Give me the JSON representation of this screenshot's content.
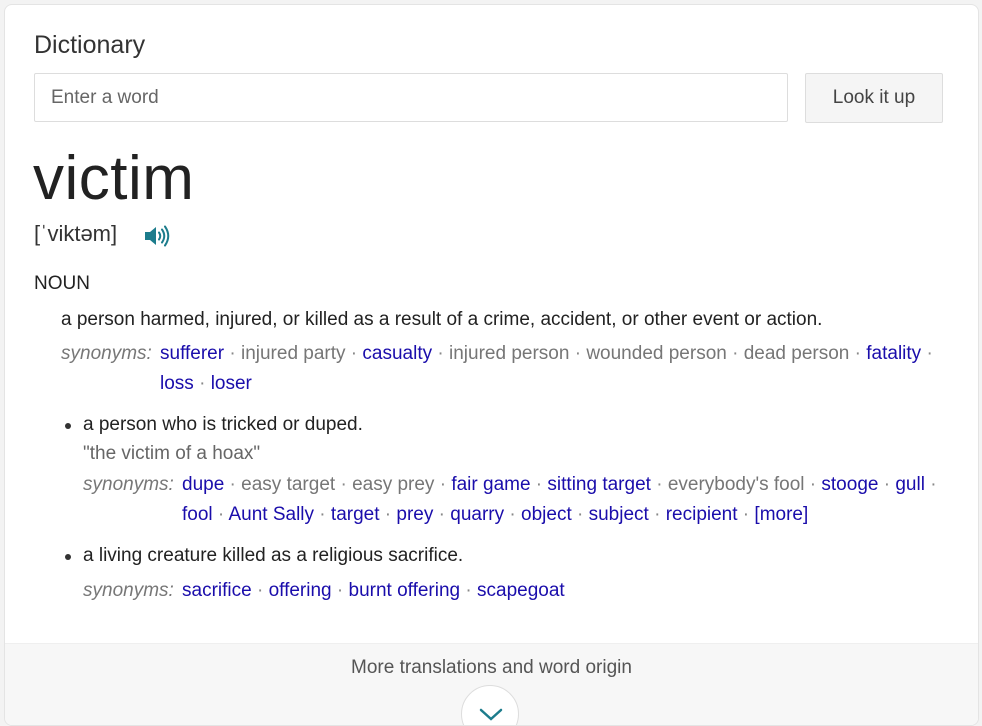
{
  "panel": {
    "title": "Dictionary",
    "search": {
      "placeholder": "Enter a word",
      "value": ""
    },
    "lookup_label": "Look it up"
  },
  "entry": {
    "word": "victim",
    "pronunciation": "[ˈviktəm]",
    "speaker_icon": "speaker-icon",
    "part_of_speech": "NOUN",
    "synonyms_label": "synonyms:",
    "senses": [
      {
        "definition": "a person harmed, injured, or killed as a result of a crime, accident, or other event or action.",
        "synonym_lines": [
          [
            {
              "text": "sufferer",
              "link": true
            },
            {
              "text": "injured party",
              "link": false
            },
            {
              "text": "casualty",
              "link": true
            },
            {
              "text": "injured person",
              "link": false
            },
            {
              "text": "wounded person",
              "link": false
            },
            {
              "text": "dead person",
              "link": false
            },
            {
              "text": "fatality",
              "link": true
            }
          ],
          [
            {
              "text": "loss",
              "link": true
            },
            {
              "text": "loser",
              "link": true
            }
          ]
        ]
      },
      {
        "definition": "a person who is tricked or duped.",
        "example": "\"the victim of a hoax\"",
        "synonym_lines": [
          [
            {
              "text": "dupe",
              "link": true
            },
            {
              "text": "easy target",
              "link": false
            },
            {
              "text": "easy prey",
              "link": false
            },
            {
              "text": "fair game",
              "link": true
            },
            {
              "text": "sitting target",
              "link": true
            },
            {
              "text": "everybody's fool",
              "link": false
            },
            {
              "text": "stooge",
              "link": true
            },
            {
              "text": "gull",
              "link": true
            }
          ],
          [
            {
              "text": "fool",
              "link": true
            },
            {
              "text": "Aunt Sally",
              "link": true
            },
            {
              "text": "target",
              "link": true
            },
            {
              "text": "prey",
              "link": true
            },
            {
              "text": "quarry",
              "link": true
            },
            {
              "text": "object",
              "link": true
            },
            {
              "text": "subject",
              "link": true
            },
            {
              "text": "recipient",
              "link": true
            },
            {
              "text": "[more]",
              "link": true
            }
          ]
        ]
      },
      {
        "definition": "a living creature killed as a religious sacrifice.",
        "synonym_lines": [
          [
            {
              "text": "sacrifice",
              "link": true
            },
            {
              "text": "offering",
              "link": true
            },
            {
              "text": "burnt offering",
              "link": true
            },
            {
              "text": "scapegoat",
              "link": true
            }
          ]
        ]
      }
    ]
  },
  "footer": {
    "more_label": "More translations and word origin",
    "expand_icon": "chevron-down-icon"
  }
}
